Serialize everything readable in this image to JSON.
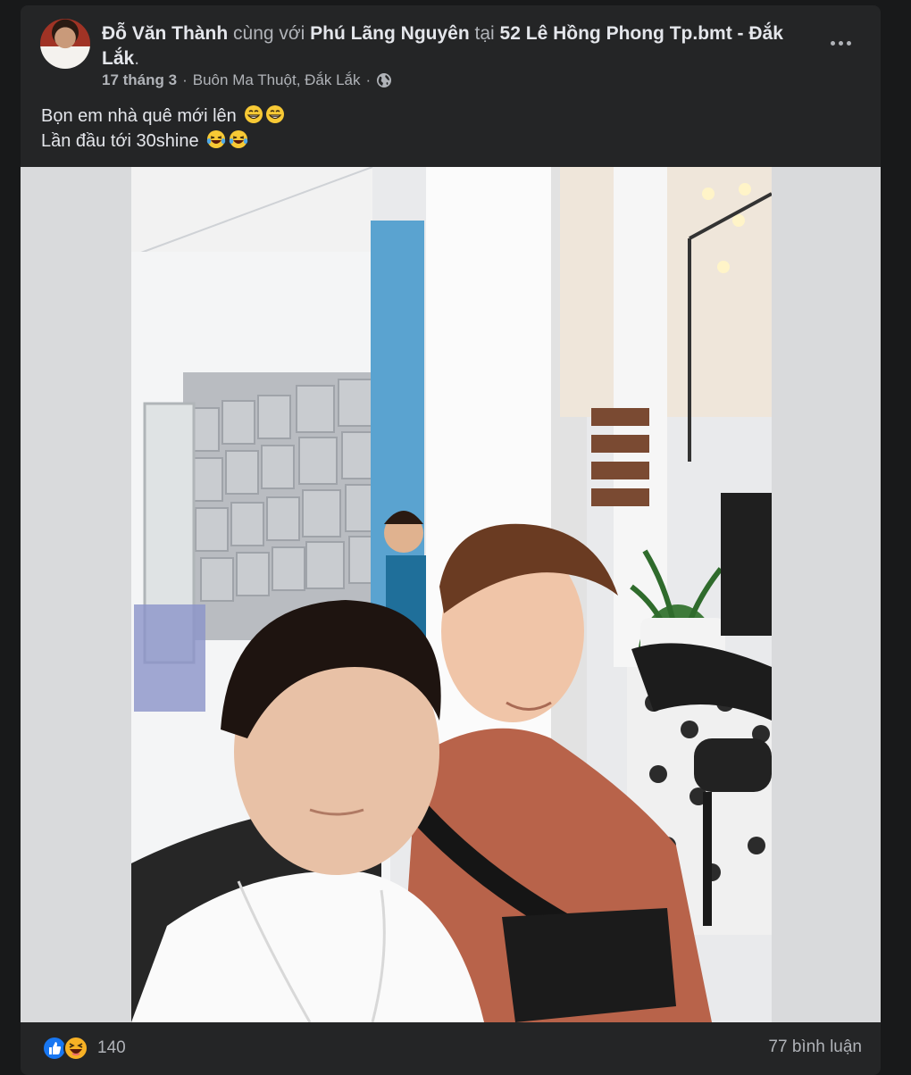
{
  "post": {
    "author": "Đỗ Văn Thành",
    "with_text": "cùng với",
    "tagged": "Phú Lãng Nguyên",
    "at_text": "tại",
    "location": "52 Lê Hồng Phong Tp.bmt - Đắk Lắk",
    "location_end": ".",
    "date": "17 tháng 3",
    "separator": "·",
    "place": "Buôn Ma Thuột, Đắk Lắk",
    "privacy_icon": "globe-icon",
    "text_line1": "Bọn em nhà quê mới lên",
    "text_line2": "Lần đầu tới 30shine",
    "line1_emoji": "grinning-emoji",
    "line2_emoji": "laughing-emoji"
  },
  "reactions": {
    "icons": [
      "like-icon",
      "haha-icon"
    ],
    "count": "140"
  },
  "comments": {
    "label": "77 bình luận"
  },
  "colors": {
    "background": "#18191a",
    "card": "#242526",
    "text": "#e4e6eb",
    "muted": "#b0b3b8",
    "like": "#1877f2",
    "haha": "#f7b125"
  }
}
